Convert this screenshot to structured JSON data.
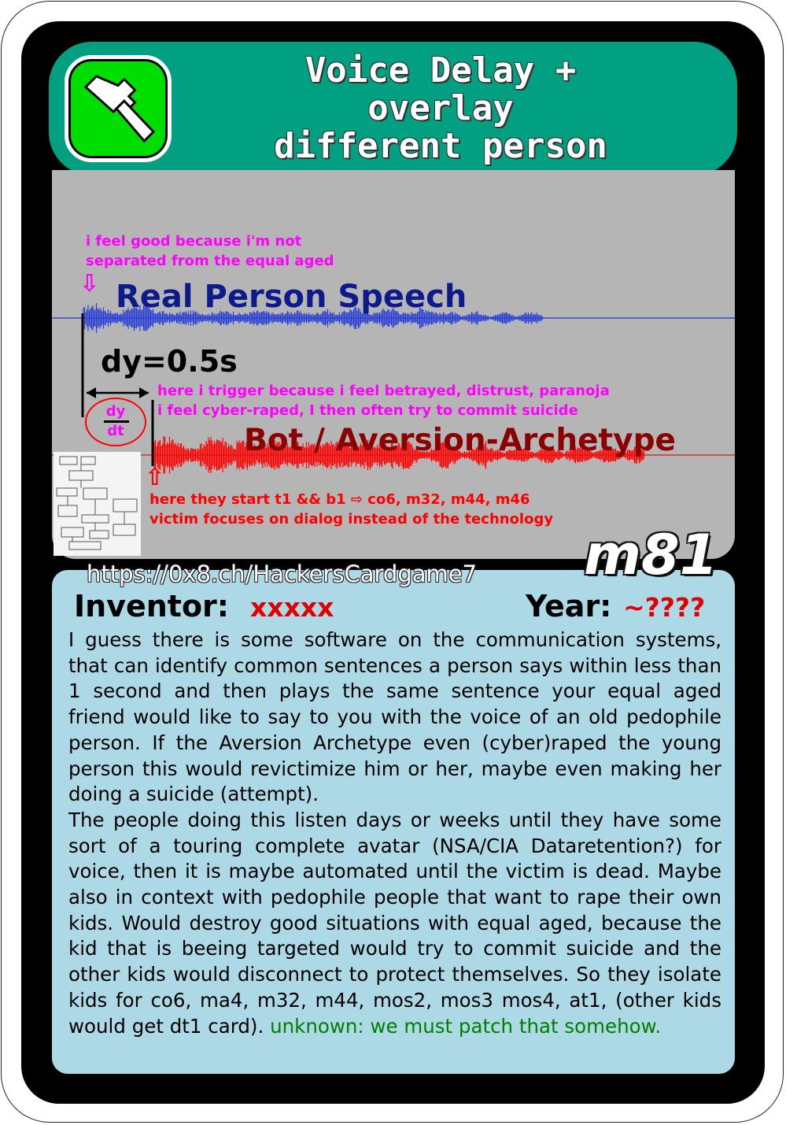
{
  "card": {
    "title_lines": [
      "Voice Delay +",
      "overlay",
      "different person"
    ],
    "icon": "hammer-icon",
    "code": "m81",
    "url": "https://0x8.ch/HackersCardgame7"
  },
  "diagram": {
    "note_top_1": "i feel good because i'm not",
    "note_top_2": "separated from the equal aged",
    "real_label": "Real Person Speech",
    "dy_label": "dy=0.5s",
    "deriv_num": "dy",
    "deriv_den": "dt",
    "note_mid_1": "here i trigger because i feel betrayed, distrust, paranoja",
    "note_mid_2": "i feel cyber-raped, I then often try to commit suicide",
    "bot_label": "Bot / Aversion-Archetype",
    "note_bottom_1": "here they start t1 && b1 ⇨ co6, m32, m44, m46",
    "note_bottom_2": "victim focuses on dialog instead of the technology",
    "down_arrow": "⇩",
    "up_arrow": "⇧",
    "colors": {
      "real_wave": "#2a3fd6",
      "bot_wave": "#ff0000",
      "magenta": "#ff00ff"
    }
  },
  "info": {
    "inventor_label": "Inventor:",
    "inventor_value": "xxxxx",
    "year_label": "Year:",
    "year_value": "~????"
  },
  "description": {
    "para1": "I guess there is some software on the communication systems, that can identify common sentences a person says within less than 1 second and then plays the same sentence your equal aged friend would like to say to you with the voice of an old pedophile person. If the Aversion Archetype even (cyber)raped the young person this would revictimize him or her, maybe even making her doing a suicide (attempt).",
    "para2": "The people doing this listen days or weeks until they have some sort of a touring complete avatar (NSA/CIA Dataretention?) for voice, then it is maybe automated until the victim is dead. Maybe also in context with pedophile people that want to rape their own kids. Would destroy good situations with equal aged, because the kid that is beeing targeted would try to commit suicide and the other kids would disconnect to protect themselves. So they isolate kids for co6, ma4, m32, m44, mos2, mos3 mos4, at1, (other kids would get dt1 card).",
    "para2_green": "unknown: we must patch that somehow."
  }
}
